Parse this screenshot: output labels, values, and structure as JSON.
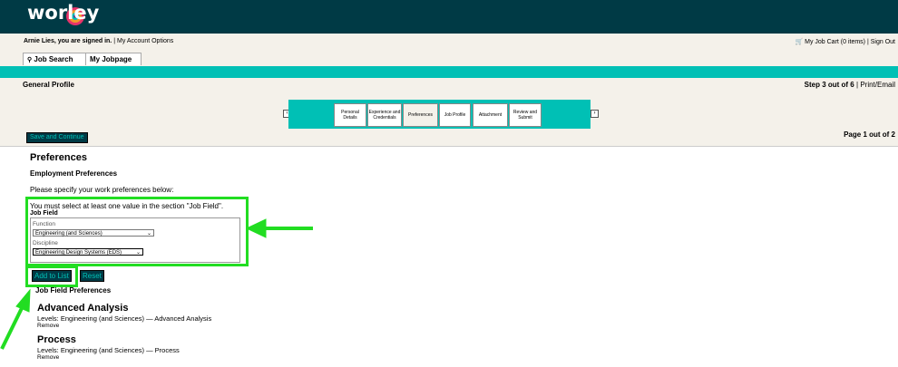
{
  "brand": {
    "name": "worley",
    "colors": {
      "dark": "#003a45",
      "teal": "#00c0b5",
      "highlight": "#22dd22"
    }
  },
  "user_bar": {
    "signed_in": "Arnie Lies, you are signed in.",
    "separator": "|",
    "account_link": "My Account Options",
    "cart": "My Job Cart (0 items)",
    "sign_out": "Sign Out"
  },
  "tabs": [
    {
      "label": "Job Search",
      "icon": "search-icon"
    },
    {
      "label": "My Jobpage"
    }
  ],
  "profile": {
    "title": "General Profile",
    "step": "Step 3 out of 6",
    "print": "Print/Email",
    "page": "Page 1 out of 2",
    "save": "Save and Continue",
    "steps": [
      "Personal Details",
      "Experience and Credentials",
      "Preferences",
      "Job Profile",
      "Attachment",
      "Review and Submit"
    ],
    "current_step": "Preferences"
  },
  "preferences": {
    "heading": "Preferences",
    "subheading": "Employment Preferences",
    "instructions": "Please specify your work preferences below:",
    "must": "You must select at least one value in the section \"Job Field\".",
    "job_field": {
      "title": "Job Field",
      "function_label": "Function",
      "function_value": "Engineering (and Sciences)",
      "discipline_label": "Discipline",
      "discipline_value": "Engineering Design Systems (EDS)"
    },
    "add_button": "Add to List",
    "reset_button": "Reset",
    "list_title": "Job Field Preferences",
    "entries": [
      {
        "title": "Advanced Analysis",
        "levels": "Levels: Engineering (and Sciences) — Advanced Analysis",
        "remove": "Remove"
      },
      {
        "title": "Process",
        "levels": "Levels: Engineering (and Sciences) — Process",
        "remove": "Remove"
      }
    ]
  }
}
